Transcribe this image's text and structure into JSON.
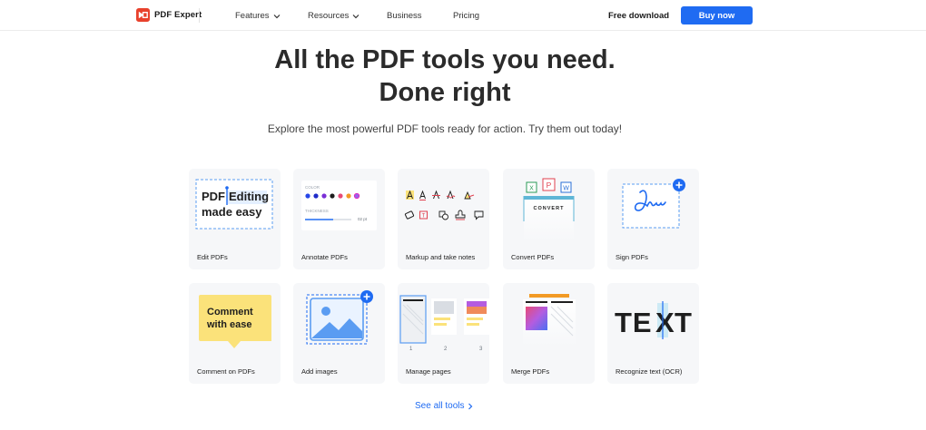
{
  "header": {
    "brand": "PDF Expert",
    "nav": [
      {
        "label": "Features",
        "dropdown": true
      },
      {
        "label": "Resources",
        "dropdown": true
      },
      {
        "label": "Business",
        "dropdown": false
      },
      {
        "label": "Pricing",
        "dropdown": false
      }
    ],
    "free_download": "Free download",
    "buy_now": "Buy now"
  },
  "hero": {
    "title_line1": "All the PDF tools you need.",
    "title_line2": "Done right",
    "subtitle": "Explore the most powerful PDF tools ready for action. Try them out today!"
  },
  "tools": [
    {
      "label": "Edit PDFs",
      "art_text_1": "PDF",
      "art_text_2": "Editing",
      "art_text_3": "made easy"
    },
    {
      "label": "Annotate PDFs",
      "art_text_1": "COLOR",
      "art_text_2": "THICKNESS",
      "art_text_3": "02 pt"
    },
    {
      "label": "Markup and take notes"
    },
    {
      "label": "Convert PDFs",
      "art_text_1": "CONVERT",
      "art_text_2": "X",
      "art_text_3": "P",
      "art_text_4": "W"
    },
    {
      "label": "Sign PDFs"
    },
    {
      "label": "Comment on PDFs",
      "art_text_1": "Comment",
      "art_text_2": "with ease"
    },
    {
      "label": "Add images"
    },
    {
      "label": "Manage pages",
      "art_text_1": "1",
      "art_text_2": "2",
      "art_text_3": "3"
    },
    {
      "label": "Merge PDFs"
    },
    {
      "label": "Recognize text (OCR)",
      "art_text_1": "TE",
      "art_text_2": "X",
      "art_text_3": "T"
    }
  ],
  "see_all": "See all tools",
  "colors": {
    "accent": "#1f6bf2",
    "brand_red": "#e8412c",
    "card_bg": "#f6f7f9",
    "comment_yellow": "#fbe27a"
  }
}
